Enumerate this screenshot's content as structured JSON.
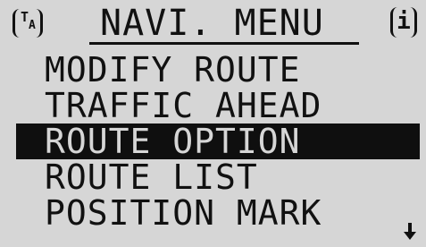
{
  "header": {
    "left_icon_name": "ta-icon",
    "left_icon_t": "T",
    "left_icon_a": "A",
    "title": "NAVI. MENU",
    "right_icon_name": "info-icon",
    "right_icon_glyph": "i"
  },
  "menu": {
    "items": [
      {
        "label": "MODIFY ROUTE",
        "selected": false
      },
      {
        "label": "TRAFFIC AHEAD",
        "selected": false
      },
      {
        "label": "ROUTE OPTION",
        "selected": true
      },
      {
        "label": "ROUTE LIST",
        "selected": false
      },
      {
        "label": "POSITION MARK",
        "selected": false
      }
    ]
  },
  "scroll": {
    "icon_name": "arrow-down-icon"
  },
  "colors": {
    "background": "#d6d6d6",
    "foreground": "#111111",
    "highlight": "#0f0f0f"
  }
}
